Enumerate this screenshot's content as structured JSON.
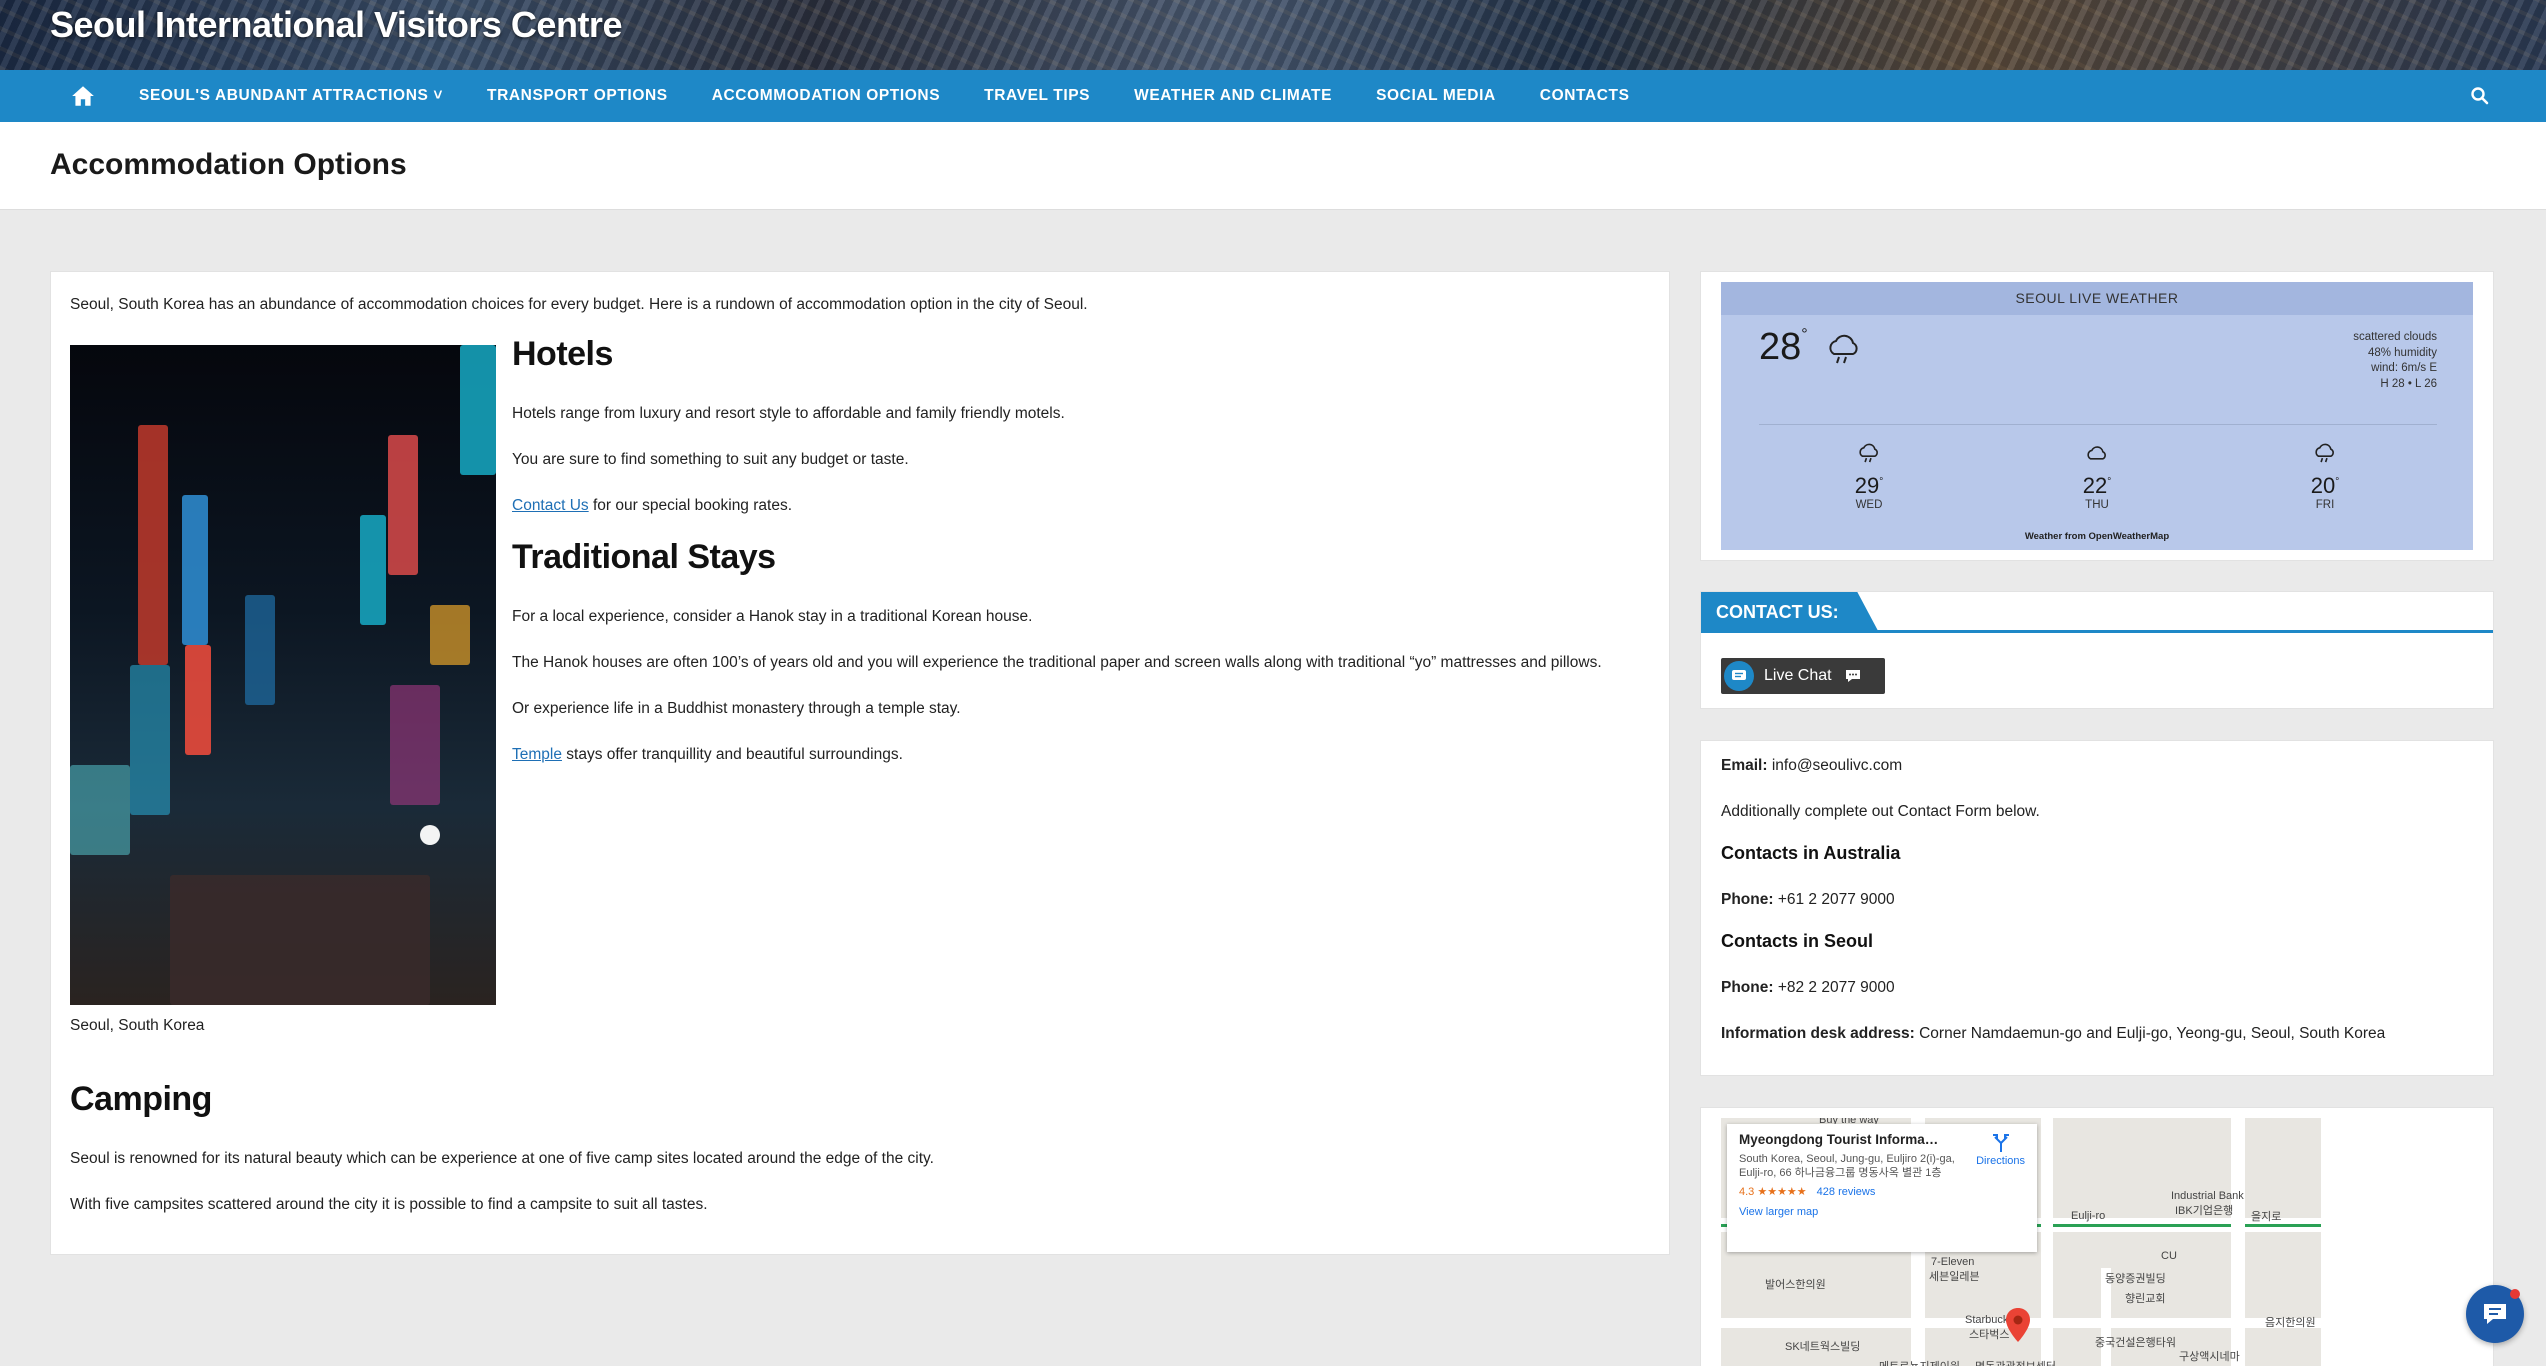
{
  "site": {
    "title": "Seoul International Visitors Centre"
  },
  "nav": {
    "items": [
      "SEOUL'S ABUNDANT ATTRACTIONS ˅",
      "TRANSPORT OPTIONS",
      "ACCOMMODATION OPTIONS",
      "TRAVEL TIPS",
      "WEATHER AND CLIMATE",
      "SOCIAL MEDIA",
      "CONTACTS"
    ]
  },
  "page": {
    "title": "Accommodation Options"
  },
  "content": {
    "intro": "Seoul, South Korea has an abundance of accommodation choices for every budget. Here is a rundown of accommodation option in the city of Seoul.",
    "caption": "Seoul, South Korea",
    "hotels": {
      "heading": "Hotels",
      "p1": "Hotels range from luxury and resort style to affordable and family friendly motels.",
      "p2": "You are sure to find something to suit any budget or taste.",
      "p3_link": "Contact Us",
      "p3_rest": " for our special booking rates."
    },
    "traditional": {
      "heading": "Traditional Stays",
      "p1": "For a local experience, consider a Hanok stay in a traditional Korean house.",
      "p2": "The Hanok houses are often 100’s of years old and you will experience the traditional paper and screen walls along with traditional “yo” mattresses and pillows.",
      "p3": "Or experience life in a Buddhist monastery through a temple stay.",
      "p4_link": "Temple",
      "p4_rest": " stays offer tranquillity and beautiful surroundings."
    },
    "camping": {
      "heading": "Camping",
      "p1": "Seoul is renowned for its natural beauty which can be experience at one of five camp sites located around the edge of the city.",
      "p2": "With five campsites scattered around the city it is possible to find a campsite to suit all tastes."
    }
  },
  "weather": {
    "header": "SEOUL LIVE WEATHER",
    "temp": "28",
    "deg": "°",
    "desc": [
      "scattered clouds",
      "48% humidity",
      "wind: 6m/s E",
      "H 28 • L 26"
    ],
    "forecast": [
      {
        "temp": "29",
        "day": "WED",
        "icon": "rain-cloud-icon"
      },
      {
        "temp": "22",
        "day": "THU",
        "icon": "cloud-icon"
      },
      {
        "temp": "20",
        "day": "FRI",
        "icon": "rain-cloud-icon"
      }
    ],
    "credit": "Weather from OpenWeatherMap"
  },
  "contact": {
    "tab": "CONTACT US:",
    "livechat": "Live Chat",
    "email_label": "Email:",
    "email": " info@seoulivc.com",
    "additional": "Additionally complete out Contact Form below.",
    "aus_heading": "Contacts in Australia",
    "phone_label": "Phone:",
    "aus_phone": " +61 2 2077 9000",
    "seoul_heading": "Contacts in Seoul",
    "seoul_phone": " +82 2 2077 9000",
    "desk_label": "Information desk address:",
    "desk": " Corner Namdaemun-go and Eulji-go, Yeong-gu, Seoul, South Korea"
  },
  "map": {
    "title": "Myeongdong Tourist Informati...",
    "address": "South Korea, Seoul, Jung-gu, Euljiro 2(i)-ga, Eulji-ro, 66 하나금융그룹 명동사옥 별관 1층",
    "rating": "4.3 ★★★★★",
    "reviews": "428 reviews",
    "directions": "Directions",
    "larger": "View larger map",
    "labels": [
      "Industrial Bank",
      "IBK기업은행",
      "Eulji-ro",
      "을지로",
      "7-Eleven",
      "세븐일레븐",
      "발어스한의원",
      "Starbucks",
      "스타벅스",
      "SK네트웍스빌딩",
      "동양증권빌딩",
      "향린교회",
      "중국건설은행타워",
      "구상액시네마",
      "메트로뇬지제이원",
      "명동관광정보센터",
      "음지한의원",
      "Buy the way",
      "CU"
    ]
  },
  "colors": {
    "accent": "#1e88c7",
    "weather_bg": "#b8c8ea"
  }
}
